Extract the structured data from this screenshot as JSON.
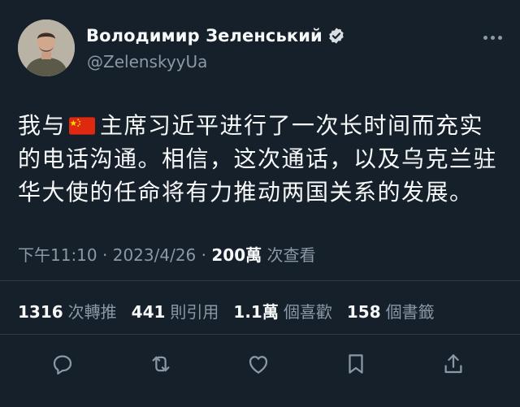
{
  "author": {
    "display_name": "Володимир Зеленський",
    "handle": "@ZelenskyyUa",
    "verified_icon": "verified-badge-icon"
  },
  "tweet": {
    "text_before_flag": "我与",
    "flag_icon": "china-flag-icon",
    "text_after_flag": "主席习近平进行了一次长时间而充实的电话沟通。相信，这次通话，以及乌克兰驻华大使的任命将有力推动两国关系的发展。"
  },
  "meta": {
    "time": "下午11:10",
    "date": "2023/4/26",
    "separator": "·",
    "views_count": "200萬",
    "views_label": "次查看"
  },
  "stats": {
    "retweets": {
      "count": "1316",
      "label": "次轉推"
    },
    "quotes": {
      "count": "441",
      "label": "則引用"
    },
    "likes": {
      "count": "1.1萬",
      "label": "個喜歡"
    },
    "bookmarks": {
      "count": "158",
      "label": "個書籤"
    }
  },
  "actions": [
    "reply-icon",
    "retweet-icon",
    "like-icon",
    "bookmark-icon",
    "share-icon"
  ],
  "colors": {
    "background": "#15202b",
    "text": "#f7f9f9",
    "secondary": "#8b98a5",
    "verified": "#1d9bf0",
    "divider": "#2f3b47"
  }
}
